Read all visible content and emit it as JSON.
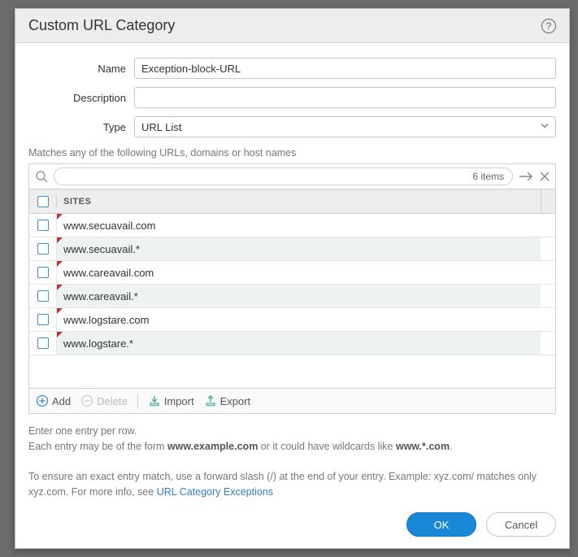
{
  "header": {
    "title": "Custom URL Category"
  },
  "form": {
    "name_label": "Name",
    "name_value": "Exception-block-URL",
    "description_label": "Description",
    "description_value": "",
    "type_label": "Type",
    "type_value": "URL List"
  },
  "matches_hint": "Matches any of the following URLs, domains or host names",
  "search": {
    "count_label": "6 items"
  },
  "list": {
    "column_label": "SITES",
    "rows": [
      {
        "site": "www.secuavail.com"
      },
      {
        "site": "www.secuavail.*"
      },
      {
        "site": "www.careavail.com"
      },
      {
        "site": "www.careavail.*"
      },
      {
        "site": "www.logstare.com"
      },
      {
        "site": "www.logstare.*"
      }
    ]
  },
  "toolbar": {
    "add_label": "Add",
    "delete_label": "Delete",
    "import_label": "Import",
    "export_label": "Export"
  },
  "footer_help": {
    "line1": "Enter one entry per row.",
    "line2a": "Each entry may be of the form ",
    "line2b": "www.example.com",
    "line2c": " or it could have wildcards like ",
    "line2d": "www.*.com",
    "line2e": ".",
    "line3a": "To ensure an exact entry match, use a forward slash (/) at the end of your entry. Example: xyz.com/ matches only xyz.com. For more info, see ",
    "link_label": "URL Category Exceptions"
  },
  "buttons": {
    "ok": "OK",
    "cancel": "Cancel"
  }
}
